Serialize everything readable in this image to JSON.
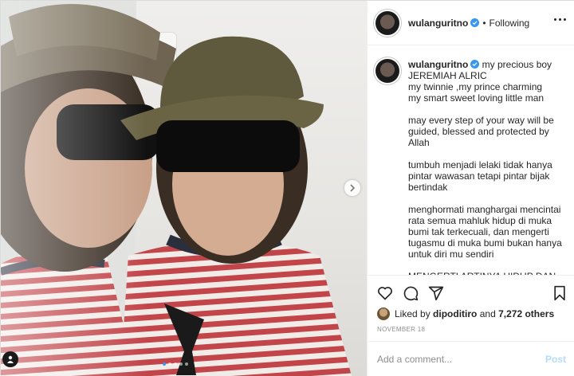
{
  "post": {
    "username": "wulanguritno",
    "verified": true,
    "separator": "•",
    "follow_status": "Following",
    "caption": {
      "username": "wulanguritno",
      "text": "my precious boy\nJEREMIAH ALRIC\nmy twinnie ,my prince charming\nmy smart sweet loving little man\n\nmay every step of your way will be guided, blessed and protected by Allah\n\ntumbuh menjadi lelaki tidak hanya pintar wawasan tetapi pintar bijak bertindak\n\nmenghormati manghargai mencintai rata semua mahluk hidup di muka bumi tak terkecuali, dan mengerti tugasmu di muka bumi bukan hanya untuk diri mu sendiri\n\nMENGERTI ARTINYA HIDUP DAN"
    },
    "likes": {
      "prefix": "Liked by",
      "user": "dipoditiro",
      "connector": "and",
      "others": "7,272 others"
    },
    "date": "NOVEMBER 18",
    "comment": {
      "placeholder": "Add a comment...",
      "post_label": "Post"
    },
    "carousel": {
      "slide_count": 5,
      "active_index": 0
    },
    "icons": [
      "more-options-icon",
      "verified-badge-icon",
      "heart-icon",
      "comment-icon",
      "share-icon",
      "bookmark-icon",
      "next-arrow-icon",
      "user-tag-icon"
    ],
    "colors": {
      "verified": "#3897f0",
      "post_button": "#b3dbff",
      "active_dot": "#3897f0"
    }
  }
}
